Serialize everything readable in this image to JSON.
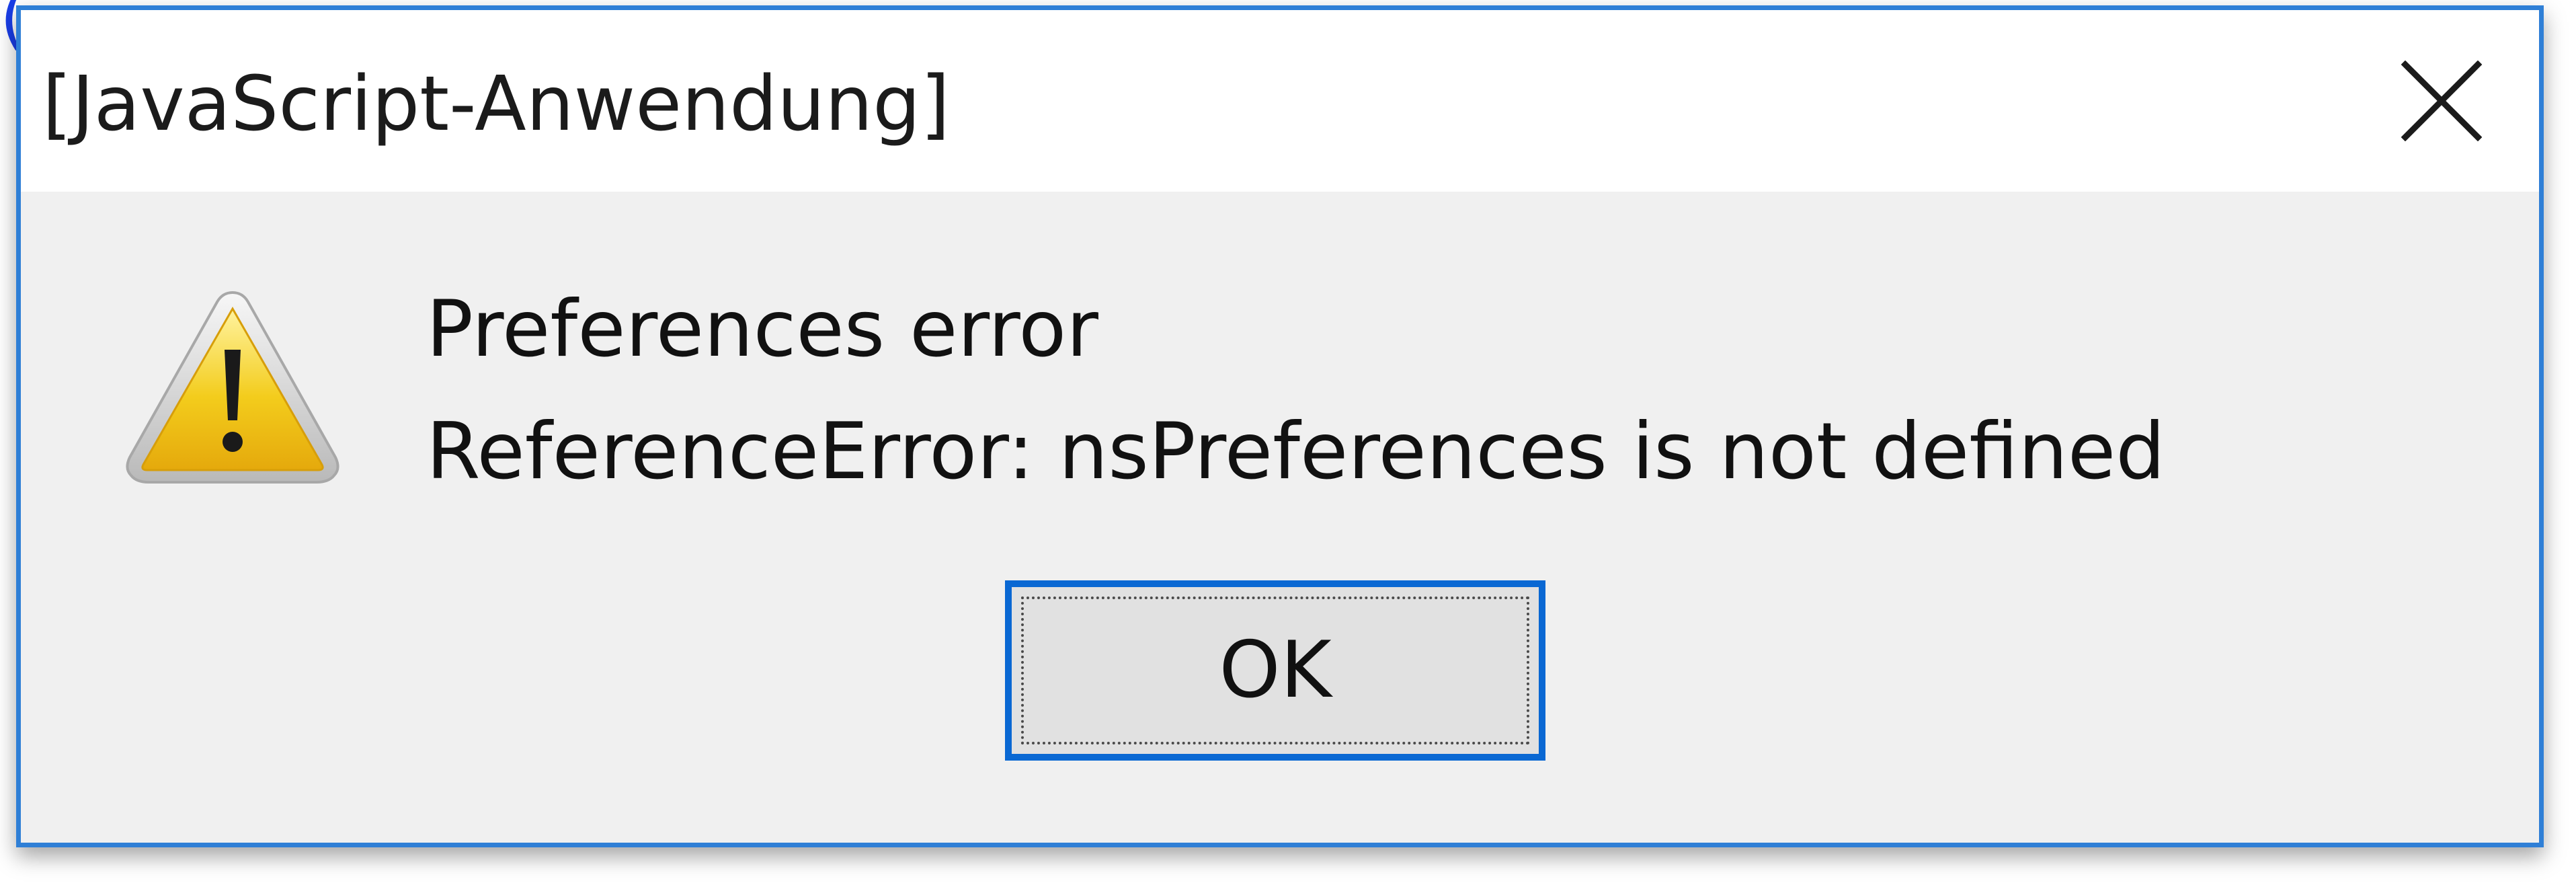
{
  "dialog": {
    "title": "[JavaScript-Anwendung]",
    "close_icon": "close-icon",
    "warning_icon": "warning-icon",
    "message_heading": "Preferences error",
    "message_detail": "ReferenceError: nsPreferences is not defined",
    "ok_label": "OK"
  },
  "colors": {
    "window_border": "#2f7fd6",
    "button_focus_border": "#0a68d3",
    "client_background": "#f0f0f0",
    "titlebar_background": "#ffffff"
  }
}
